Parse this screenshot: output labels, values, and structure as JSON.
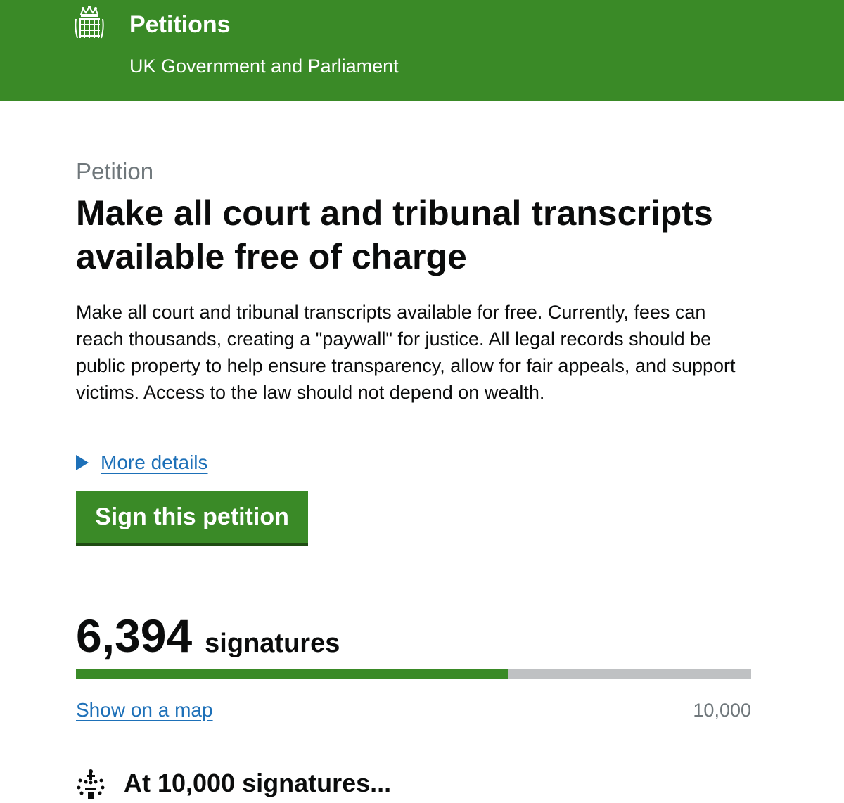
{
  "header": {
    "title": "Petitions",
    "subtitle": "UK Government and Parliament",
    "logo_icon": "portcullis-icon",
    "background_color": "#3a8a27"
  },
  "petition": {
    "caption": "Petition",
    "title": "Make all court and tribunal transcripts available free of charge",
    "summary": "Make all court and tribunal transcripts available for free. Currently, fees can reach thousands, creating a \"paywall\" for justice. All legal records should be public property to help ensure transparency, allow for fair appeals, and support victims. Access to the law should not depend on wealth.",
    "more_details_label": "More details",
    "sign_button_label": "Sign this petition"
  },
  "signatures": {
    "count_display": "6,394",
    "count": 6394,
    "label": "signatures",
    "target_display": "10,000",
    "target": 10000,
    "progress_fraction": 0.6394,
    "map_link_label": "Show on a map"
  },
  "threshold": {
    "heading": "At 10,000 signatures...",
    "icon": "crown-icon"
  },
  "colors": {
    "brand_green": "#3a8a27",
    "link_blue": "#1d70b8",
    "progress_track": "#bfc1c3",
    "secondary_text": "#6f777b"
  }
}
